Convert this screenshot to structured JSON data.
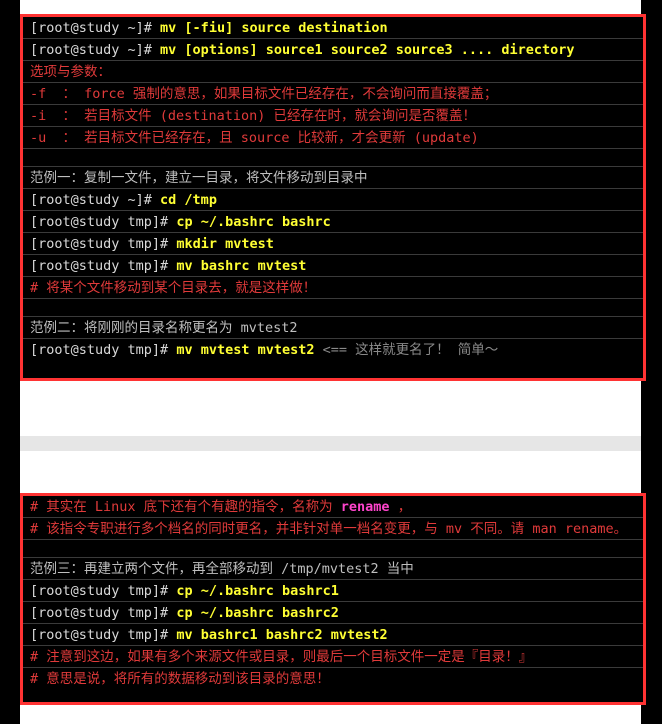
{
  "theme": {
    "page_background": "#ffffff",
    "outer_background": "#000000",
    "code_background": "#000000",
    "code_border": "#ff3333",
    "line_separator": "#3a3a3a",
    "band_color": "#e6e6e6",
    "color_prompt": "#d9d9d9",
    "color_command": "#ffff33",
    "color_comment": "#e03a3a",
    "color_note": "#8a8a8a",
    "color_keyword": "#ff44cc"
  },
  "blocks": [
    {
      "id": "mv-usage-block",
      "lines": [
        {
          "id": "l1",
          "type": "command",
          "prompt": "[root@study ~]# ",
          "command": "mv [-fiu] source destination"
        },
        {
          "id": "l2",
          "type": "command",
          "prompt": "[root@study ~]# ",
          "command": "mv [options] source1 source2 source3 .... directory"
        },
        {
          "id": "l3",
          "type": "comment",
          "text": "选项与参数："
        },
        {
          "id": "l4",
          "type": "comment",
          "text": "-f  ： force 强制的意思，如果目标文件已经存在，不会询问而直接覆盖；"
        },
        {
          "id": "l5",
          "type": "comment",
          "text": "-i  ： 若目标文件 (destination) 已经存在时，就会询问是否覆盖！"
        },
        {
          "id": "l6",
          "type": "comment",
          "text": "-u  ： 若目标文件已经存在，且 source 比较新，才会更新 (update)"
        },
        {
          "id": "l7",
          "type": "blank",
          "text": ""
        },
        {
          "id": "l8",
          "type": "plain",
          "text": "范例一：复制一文件，建立一目录，将文件移动到目录中"
        },
        {
          "id": "l9",
          "type": "command",
          "prompt": "[root@study ~]# ",
          "command": "cd /tmp"
        },
        {
          "id": "l10",
          "type": "command",
          "prompt": "[root@study tmp]# ",
          "command": "cp ~/.bashrc bashrc"
        },
        {
          "id": "l11",
          "type": "command",
          "prompt": "[root@study tmp]# ",
          "command": "mkdir mvtest"
        },
        {
          "id": "l12",
          "type": "command",
          "prompt": "[root@study tmp]# ",
          "command": "mv bashrc mvtest"
        },
        {
          "id": "l13",
          "type": "comment",
          "text": "# 将某个文件移动到某个目录去，就是这样做！"
        },
        {
          "id": "l14",
          "type": "blank",
          "text": ""
        },
        {
          "id": "l15",
          "type": "plain",
          "text": "范例二：将刚刚的目录名称更名为 mvtest2"
        },
        {
          "id": "l16",
          "type": "command-note",
          "prompt": "[root@study tmp]# ",
          "command": "mv mvtest mvtest2",
          "note": " <== 这样就更名了！ 简单～"
        }
      ]
    },
    {
      "id": "rename-note-block",
      "lines": [
        {
          "id": "m1",
          "type": "comment-keyword",
          "before": "# 其实在 Linux 底下还有个有趣的指令，名称为 ",
          "keyword": "rename",
          "after": " ，"
        },
        {
          "id": "m2",
          "type": "comment",
          "text": "# 该指令专职进行多个档名的同时更名，并非针对单一档名变更，与 mv 不同。请 man rename。"
        },
        {
          "id": "m3",
          "type": "blank",
          "text": ""
        },
        {
          "id": "m4",
          "type": "plain",
          "text": "范例三：再建立两个文件，再全部移动到 /tmp/mvtest2 当中"
        },
        {
          "id": "m5",
          "type": "command",
          "prompt": "[root@study tmp]# ",
          "command": "cp ~/.bashrc bashrc1"
        },
        {
          "id": "m6",
          "type": "command",
          "prompt": "[root@study tmp]# ",
          "command": "cp ~/.bashrc bashrc2"
        },
        {
          "id": "m7",
          "type": "command",
          "prompt": "[root@study tmp]# ",
          "command": "mv bashrc1 bashrc2 mvtest2"
        },
        {
          "id": "m8",
          "type": "comment",
          "text": "# 注意到这边，如果有多个来源文件或目录，则最后一个目标文件一定是『目录！』"
        },
        {
          "id": "m9",
          "type": "comment",
          "text": "# 意思是说，将所有的数据移动到该目录的意思！"
        }
      ]
    }
  ]
}
